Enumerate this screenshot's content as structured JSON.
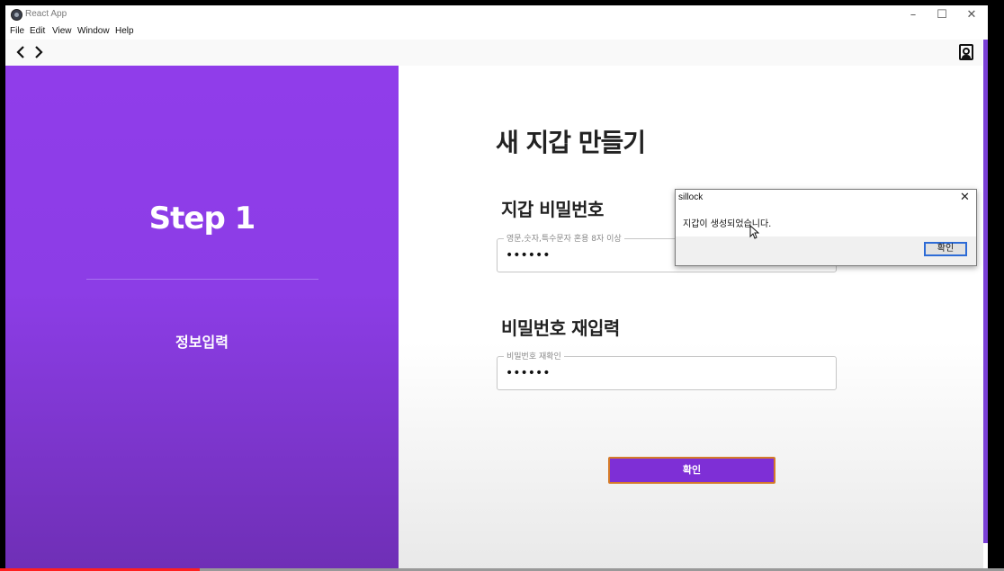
{
  "window": {
    "title": "React App",
    "min_icon": "minimize-icon",
    "max_icon": "maximize-icon",
    "close_icon": "close-icon"
  },
  "menu": {
    "items": [
      "File",
      "Edit",
      "View",
      "Window",
      "Help"
    ]
  },
  "toolbar": {
    "back_icon": "chevron-left-icon",
    "forward_icon": "chevron-right-icon",
    "profile_icon": "user-icon"
  },
  "left": {
    "step_title": "Step 1",
    "step_label": "정보입력"
  },
  "form": {
    "page_title": "새 지갑 만들기",
    "password_title": "지갑 비밀번호",
    "password_legend": "영문,숫자,특수문자 혼용 8자 이상",
    "password_value": "••••••",
    "confirm_title": "비밀번호 재입력",
    "confirm_legend": "비밀번호 재확인",
    "confirm_value": "••••••",
    "submit_label": "확인"
  },
  "dialog": {
    "title": "sillock",
    "message": "지갑이 생성되었습니다.",
    "ok_label": "확인"
  },
  "colors": {
    "accent": "#903dea",
    "button": "#7e2fd6",
    "button_border": "#d47a2a"
  }
}
